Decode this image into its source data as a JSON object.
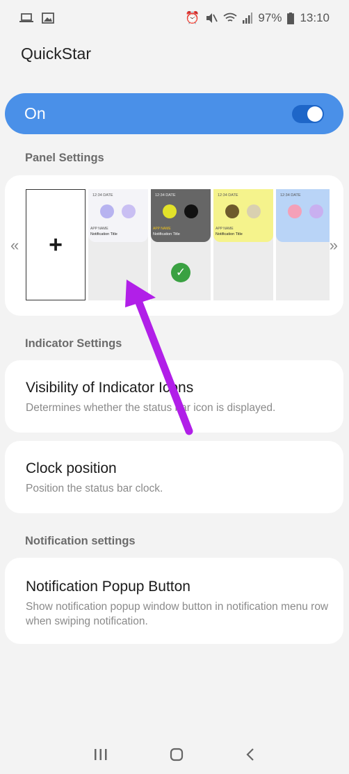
{
  "status": {
    "battery": "97%",
    "time": "13:10"
  },
  "app": {
    "title": "QuickStar"
  },
  "master": {
    "label": "On"
  },
  "panel_settings": {
    "header": "Panel Settings",
    "add_symbol": "+",
    "prev_symbol": "«",
    "next_symbol": "»",
    "thumbs": [
      {
        "time": "12:34  DATE",
        "app": "APP NAME",
        "title": "Notification Title",
        "bg": "#f4f4f8",
        "circle_a": "#b7b3f0",
        "circle_b": "#c9bff3"
      },
      {
        "time": "12:34  DATE",
        "app": "APP NAME",
        "title": "Notification Title",
        "bg": "#666666",
        "circle_a": "#e2e22a",
        "circle_b": "#111111"
      },
      {
        "time": "12:34  DATE",
        "app": "APP NAME",
        "title": "Notification Title",
        "bg": "#f5f38c",
        "circle_a": "#6e5a2c",
        "circle_b": "#d9d0b0"
      },
      {
        "time": "12:34  DATE",
        "app": "",
        "title": "",
        "bg": "#b9d4f7",
        "circle_a": "#f4a0b8",
        "circle_b": "#c9b0f0"
      }
    ]
  },
  "indicator_settings": {
    "header": "Indicator Settings",
    "visibility_title": "Visibility of Indicator Icons",
    "visibility_desc": "Determines whether the status bar icon is displayed.",
    "clock_title": "Clock position",
    "clock_desc": "Position the status bar clock."
  },
  "notification_settings": {
    "header": "Notification settings",
    "popup_title": "Notification Popup Button",
    "popup_desc": "Show notification popup window button in notification menu row when swiping notification."
  },
  "colors": {
    "accent": "#4a90e8",
    "annotation_arrow": "#b11fe8",
    "check": "#3aa142"
  }
}
